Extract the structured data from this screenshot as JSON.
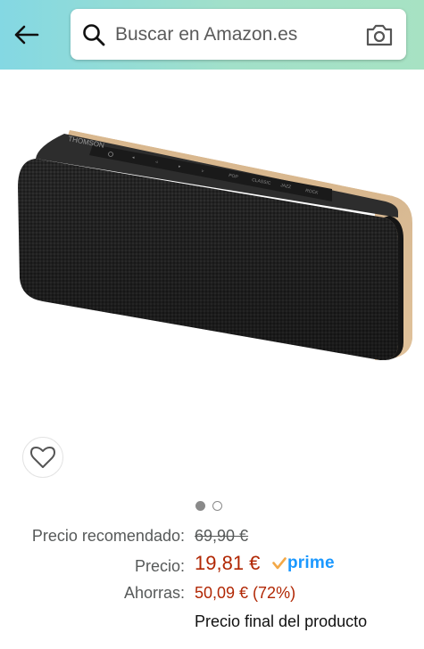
{
  "header": {
    "search_placeholder": "Buscar en Amazon.es",
    "icons": [
      "back-arrow-icon",
      "search-icon",
      "camera-icon"
    ]
  },
  "product": {
    "brand_on_device": "THOMSON",
    "panel_labels": [
      "POP",
      "CLASSIC",
      "JAZZ",
      "ROCK"
    ],
    "image_index": 1,
    "image_count": 2
  },
  "pricing": {
    "list_price_label": "Precio recomendado:",
    "list_price_value": "69,90 €",
    "price_label": "Precio:",
    "price_value": "19,81 €",
    "prime_badge": "prime",
    "savings_label": "Ahorras:",
    "savings_value": "50,09 € (72%)",
    "final_note": "Precio final del producto"
  },
  "colors": {
    "header_gradient_start": "#84d8e3",
    "header_gradient_end": "#a7e2c3",
    "price_red": "#b12704",
    "prime_blue": "#1a98ff",
    "label_gray": "#565959"
  }
}
